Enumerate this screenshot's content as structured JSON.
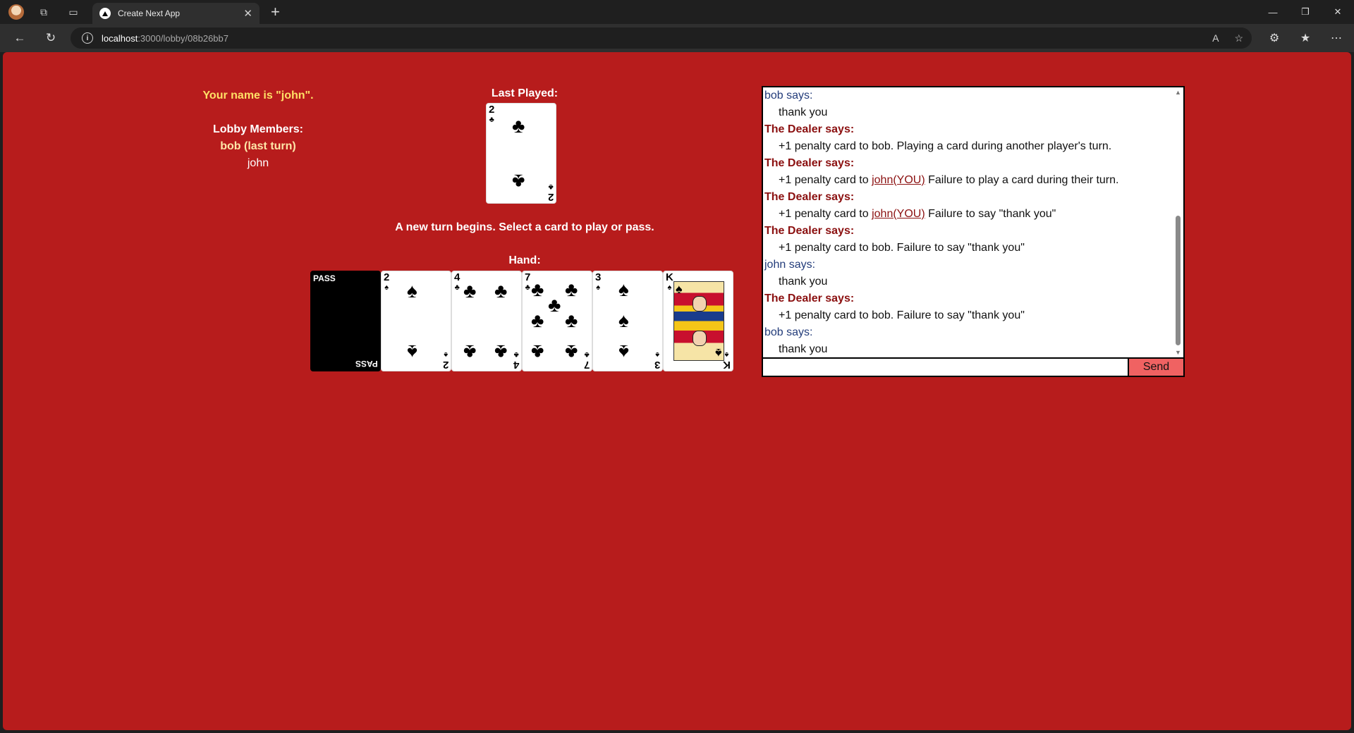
{
  "browser": {
    "tab_title": "Create Next App",
    "url_host": "localhost",
    "url_path": ":3000/lobby/08b26bb7"
  },
  "game": {
    "your_name": "Your name is \"john\".",
    "members_title": "Lobby Members:",
    "members": [
      "bob (last turn)",
      "john"
    ],
    "last_played_title": "Last Played:",
    "last_played_card": {
      "rank": "2",
      "suit": "♣"
    },
    "status": "A new turn begins. Select a card to play or pass.",
    "hand_title": "Hand:",
    "pass_label": "PASS",
    "hand": [
      {
        "rank": "2",
        "suit": "♠"
      },
      {
        "rank": "4",
        "suit": "♣"
      },
      {
        "rank": "7",
        "suit": "♣"
      },
      {
        "rank": "3",
        "suit": "♠"
      },
      {
        "rank": "K",
        "suit": "♠"
      }
    ]
  },
  "chat": {
    "messages": [
      {
        "sender": "bob says:",
        "type": "user",
        "pre": "thank you",
        "mention": "",
        "post": ""
      },
      {
        "sender": "The Dealer says:",
        "type": "dealer",
        "pre": "+1 penalty card to bob. Playing a card during another player's turn.",
        "mention": "",
        "post": ""
      },
      {
        "sender": "The Dealer says:",
        "type": "dealer",
        "pre": "+1 penalty card to ",
        "mention": "john(YOU)",
        "post": " Failure to play a card during their turn."
      },
      {
        "sender": "The Dealer says:",
        "type": "dealer",
        "pre": "+1 penalty card to ",
        "mention": "john(YOU)",
        "post": " Failure to say \"thank you\""
      },
      {
        "sender": "The Dealer says:",
        "type": "dealer",
        "pre": "+1 penalty card to bob. Failure to say \"thank you\"",
        "mention": "",
        "post": ""
      },
      {
        "sender": "john says:",
        "type": "user",
        "pre": "thank you",
        "mention": "",
        "post": ""
      },
      {
        "sender": "The Dealer says:",
        "type": "dealer",
        "pre": "+1 penalty card to bob. Failure to say \"thank you\"",
        "mention": "",
        "post": ""
      },
      {
        "sender": "bob says:",
        "type": "user",
        "pre": "thank you",
        "mention": "",
        "post": ""
      }
    ],
    "input_value": "",
    "send_label": "Send"
  }
}
